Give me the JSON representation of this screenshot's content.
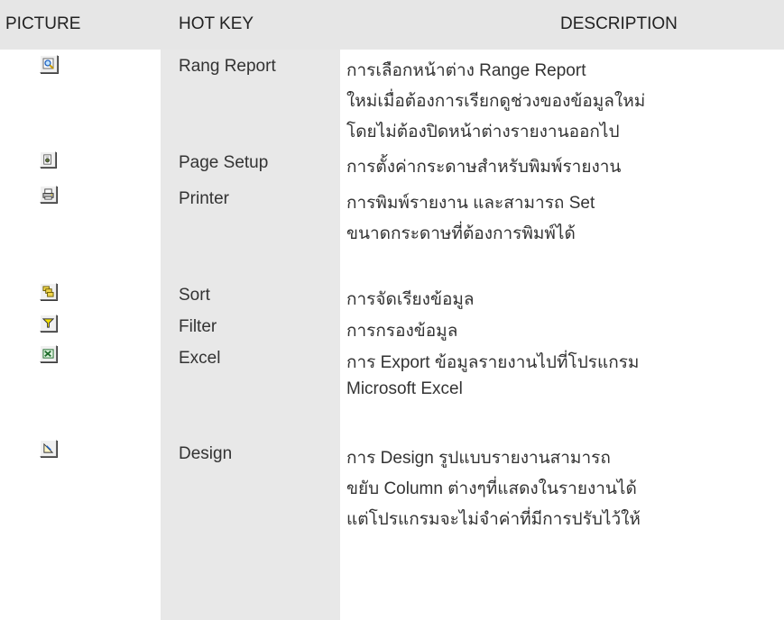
{
  "header": {
    "picture": "PICTURE",
    "hot_key": "HOT  KEY",
    "description": "DESCRIPTION"
  },
  "rows": [
    {
      "icon": "range-report-icon",
      "hotkey": "Rang Report",
      "desc": [
        "การเลือกหน้าต่าง Range Report",
        "ใหม่เมื่อต้องการเรียกดูช่วงของข้อมูลใหม่",
        "โดยไม่ต้องปิดหน้าต่างรายงานออกไป"
      ]
    },
    {
      "icon": "page-setup-icon",
      "hotkey": "Page Setup",
      "desc": [
        "การตั้งค่ากระดาษสำหรับพิมพ์รายงาน"
      ]
    },
    {
      "icon": "printer-icon",
      "hotkey": "Printer",
      "desc": [
        "การพิมพ์รายงาน และสามารถ Set",
        "ขนาดกระดาษที่ต้องการพิมพ์ได้"
      ]
    },
    {
      "icon": "sort-icon",
      "hotkey": "Sort",
      "desc": [
        "การจัดเรียงข้อมูล"
      ]
    },
    {
      "icon": "filter-icon",
      "hotkey": "Filter",
      "desc": [
        "การกรองข้อมูล"
      ]
    },
    {
      "icon": "excel-icon",
      "hotkey": "Excel",
      "desc": [
        "การ Export ข้อมูลรายงานไปที่โปรแกรม",
        "Microsoft Excel"
      ]
    },
    {
      "icon": "design-icon",
      "hotkey": "Design",
      "desc": [
        "การ Design รูปแบบรายงานสามารถ",
        "ขยับ Column ต่างๆที่แสดงในรายงานได้",
        "แต่โปรแกรมจะไม่จำค่าที่มีการปรับไว้ให้"
      ]
    }
  ]
}
